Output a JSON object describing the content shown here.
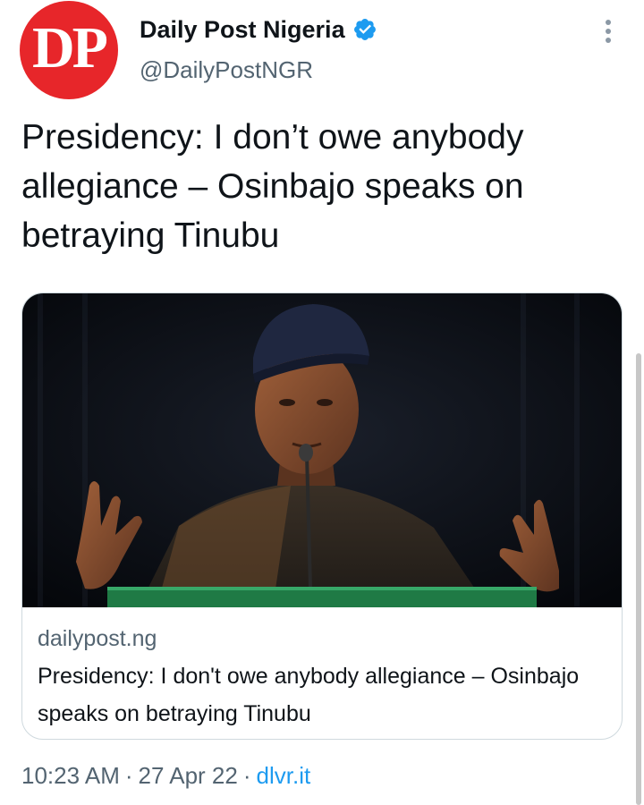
{
  "account": {
    "avatar_text": "DP",
    "display_name": "Daily Post Nigeria",
    "handle": "@DailyPostNGR",
    "verified": true,
    "avatar_color": "#e7262a",
    "verified_color": "#1d9bf0"
  },
  "tweet": {
    "text": "Presidency: I don’t owe anybody allegiance – Osinbajo speaks on betraying Tinubu"
  },
  "link_card": {
    "domain": "dailypost.ng",
    "title": "Presidency: I don't owe anybody allegiance – Osinbajo speaks on betraying Tinubu",
    "image_icon": "news-photo-speaker-at-podium"
  },
  "meta": {
    "time": "10:23 AM",
    "date": "27 Apr 22",
    "source": "dlvr.it",
    "separator": "·"
  },
  "icons": {
    "more": "more-vertical-icon",
    "verified": "verified-badge-icon"
  },
  "colors": {
    "text_primary": "#0f1419",
    "text_secondary": "#536471",
    "link": "#1d9bf0",
    "border": "#cfd9de"
  }
}
